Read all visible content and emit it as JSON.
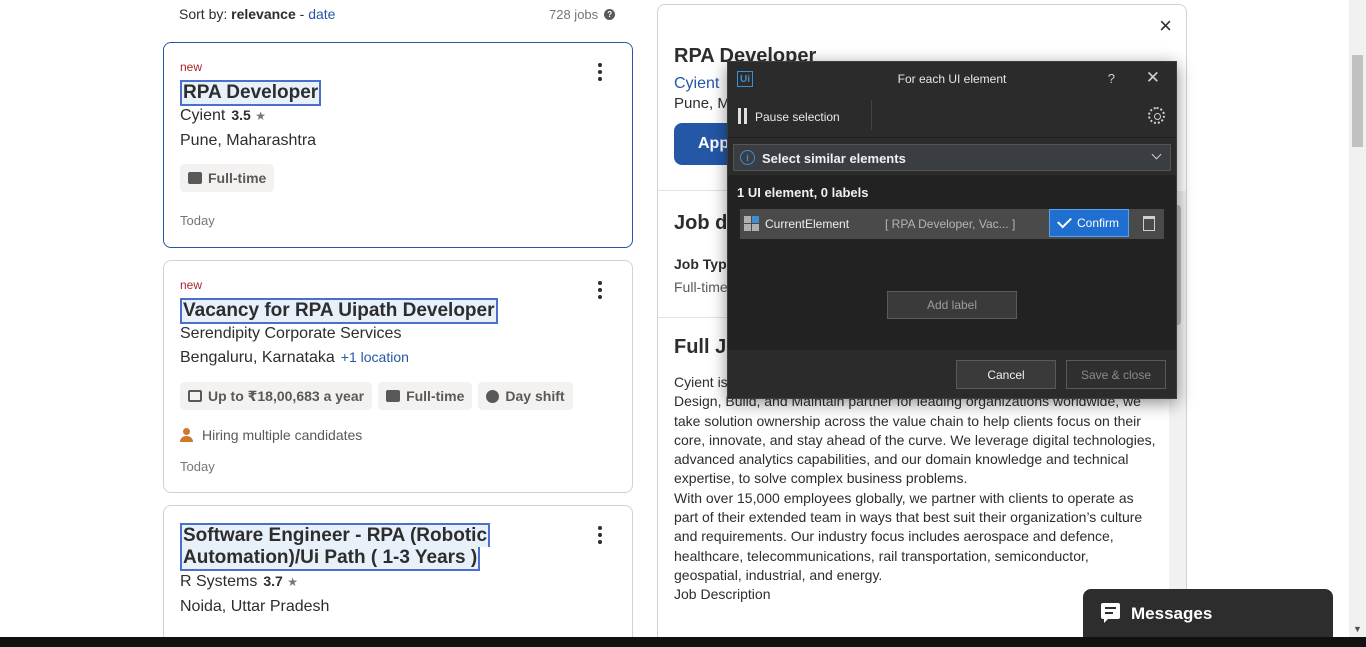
{
  "sort": {
    "label": "Sort by:",
    "active": "relevance",
    "separator": "-",
    "alt": "date"
  },
  "job_count": "728 jobs",
  "jobs": [
    {
      "new": "new",
      "title": "RPA Developer",
      "company": "Cyient",
      "rating": "3.5",
      "location": "Pune, Maharashtra",
      "tags": [
        "Full-time"
      ],
      "posted": "Today"
    },
    {
      "new": "new",
      "title": "Vacancy for RPA Uipath Developer",
      "company": "Serendipity Corporate Services",
      "location": "Bengaluru, Karnataka",
      "more_locations": "+1 location",
      "tags": [
        "Up to ₹18,00,683 a year",
        "Full-time",
        "Day shift"
      ],
      "hiring": "Hiring multiple candidates",
      "posted": "Today"
    },
    {
      "title_line1": "Software Engineer - RPA (Robotic",
      "title_line2": "Automation)/Ui Path ( 1-3 Years )",
      "company": "R Systems",
      "rating": "3.7",
      "location": "Noida, Uttar Pradesh"
    }
  ],
  "detail": {
    "title": "RPA Developer",
    "company": "Cyient",
    "location": "Pune, M",
    "apply": "App",
    "job_details_heading": "Job de",
    "job_type_label": "Job Type",
    "job_type_value": "Full-time",
    "full_desc_heading": "Full Jo",
    "desc_p1": "Cyient is",
    "desc_p2": "Design, Build, and Maintain partner for leading organizations worldwide, we take solution ownership across the value chain to help clients focus on their core, innovate, and stay ahead of the curve. We leverage digital technologies, advanced analytics capabilities, and our domain knowledge and technical expertise, to solve complex business problems.",
    "desc_p3": "With over 15,000 employees globally, we partner with clients to operate as part of their extended team in ways that best suit their organization’s culture and requirements. Our industry focus includes aerospace and defence, healthcare, telecommunications, rail transportation, semiconductor, geospatial, industrial, and energy.",
    "desc_p4": "Job Description"
  },
  "dialog": {
    "title": "For each UI element",
    "logo": "Ui",
    "help": "?",
    "pause": "Pause selection",
    "mode": "Select similar elements",
    "count": "1 UI element, 0 labels",
    "element_name": "CurrentElement",
    "element_value": "[ RPA Developer, Vac... ]",
    "confirm": "Confirm",
    "add_label": "Add label",
    "cancel": "Cancel",
    "save_close": "Save & close"
  },
  "messages": "Messages",
  "colors": {
    "accent": "#2557a7",
    "dialog_bg": "#2b2b2b",
    "confirm_blue": "#1e6fcf",
    "new_tag": "#a9252b"
  }
}
